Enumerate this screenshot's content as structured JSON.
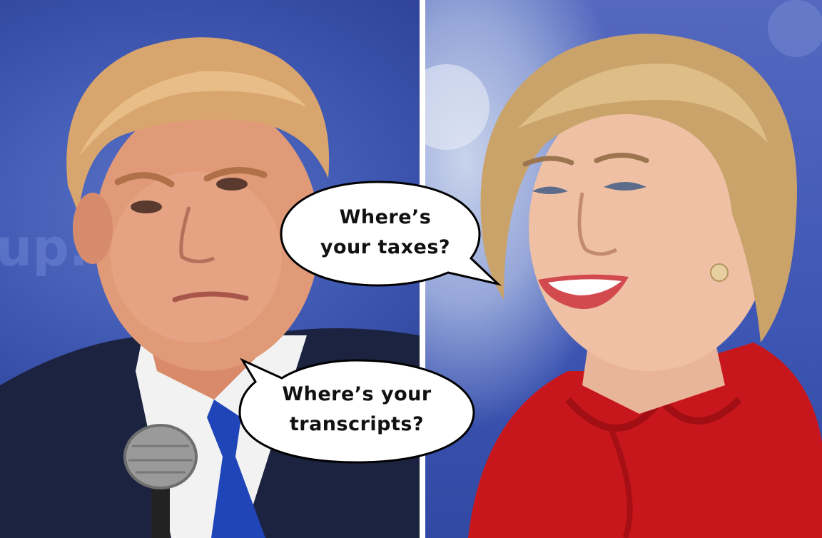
{
  "bubbles": {
    "top": {
      "line1": "Where’s",
      "line2": "your taxes?"
    },
    "bottom": {
      "line1": "Where’s your",
      "line2": "transcripts?"
    }
  },
  "colors": {
    "left_background": "#3f58b2",
    "right_background": "#4a5fba",
    "red_jacket": "#c8171c",
    "navy_suit": "#1c2340",
    "blue_tie": "#1f45b8",
    "divider": "#ffffff",
    "bubble_fill": "#ffffff",
    "bubble_stroke": "#000000"
  }
}
